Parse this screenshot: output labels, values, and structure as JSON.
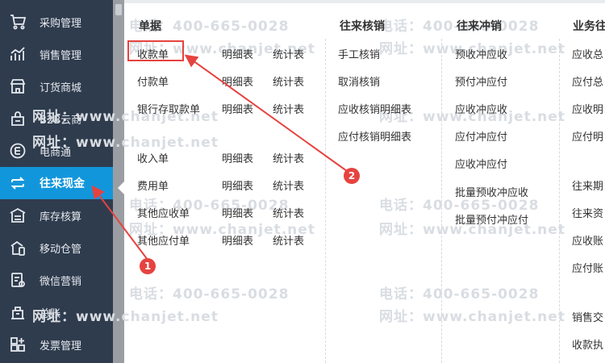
{
  "sidebar": {
    "items": [
      {
        "label": "采购管理",
        "icon": "shopping-cart-icon"
      },
      {
        "label": "销售管理",
        "icon": "sales-chart-icon"
      },
      {
        "label": "订货商城",
        "icon": "store-icon"
      },
      {
        "label": "B2B云商",
        "icon": "cloud-shop-icon"
      },
      {
        "label": "电商通",
        "icon": "ecommerce-icon"
      },
      {
        "label": "往来现金",
        "icon": "transfer-arrows-icon",
        "active": true
      },
      {
        "label": "库存核算",
        "icon": "warehouse-icon"
      },
      {
        "label": "移动仓管",
        "icon": "mobile-warehouse-icon"
      },
      {
        "label": "微信营销",
        "icon": "wechat-marketing-icon"
      },
      {
        "label": "总账",
        "icon": "ledger-icon"
      },
      {
        "label": "发票管理",
        "icon": "invoice-icon"
      }
    ]
  },
  "columns": {
    "documents": {
      "title": "单据",
      "rows": [
        {
          "name": "收款单",
          "detail": "明细表",
          "stats": "统计表"
        },
        {
          "name": "付款单",
          "detail": "明细表",
          "stats": "统计表"
        },
        {
          "name": "银行存取款单",
          "detail": "明细表",
          "stats": "统计表"
        },
        {
          "name": "收入单",
          "detail": "明细表",
          "stats": "统计表"
        },
        {
          "name": "费用单",
          "detail": "明细表",
          "stats": "统计表"
        },
        {
          "name": "其他应收单",
          "detail": "明细表",
          "stats": "统计表"
        },
        {
          "name": "其他应付单",
          "detail": "明细表",
          "stats": "统计表"
        }
      ]
    },
    "writeoff": {
      "title": "往来核销",
      "items": [
        "手工核销",
        "取消核销",
        "应收核销明细表",
        "应付核销明细表"
      ]
    },
    "offset": {
      "title": "往来冲销",
      "items": [
        "预收冲应收",
        "预付冲应付",
        "应收冲应收",
        "应付冲应付",
        "应收冲应付",
        "批量预收冲应收",
        "批量预付冲应付"
      ]
    },
    "business": {
      "title": "业务往",
      "items": [
        "应收总",
        "应付总",
        "应收明",
        "应付明",
        "往来期",
        "往来资",
        "应收账",
        "应付账",
        "销售交",
        "收款执"
      ]
    }
  },
  "watermark": {
    "phone": "电话：400-665-0028",
    "site": "网址：www.chanjet.net"
  },
  "annotations": {
    "badge1": "1",
    "badge2": "2"
  },
  "colors": {
    "sidebar_bg": "#2f3c4e",
    "active_bg": "#1296db",
    "annotation_red": "#e64340"
  }
}
